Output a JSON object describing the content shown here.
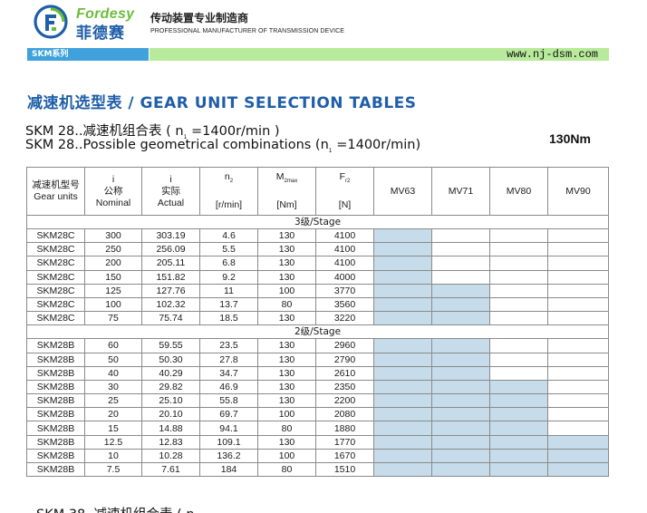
{
  "brand": {
    "name_en": "Fordesy",
    "name_cn": "菲德赛",
    "tagline_cn": "传动装置专业制造商",
    "tagline_en": "PROFESSIONAL MANUFACTURER OF TRANSMISSION DEVICE",
    "colors": {
      "green": "#6cbd3c",
      "blue": "#1f5ea8",
      "bar_blue": "#3fa2dc",
      "bar_green": "#b7ea9a",
      "cell_fill": "#c7dcea"
    }
  },
  "bar": {
    "series_label": "SKM系列",
    "url": "www.nj-dsm.com"
  },
  "title": "减速机选型表 / GEAR UNIT SELECTION TABLES",
  "subtitle_cn_pre": "SKM 28..减速机组合表 ( n",
  "subtitle_cn_sub": "1",
  "subtitle_cn_post": " =1400r/min )",
  "subtitle_en_pre": "SKM 28..Possible geometrical combinations (n",
  "subtitle_en_sub": "1",
  "subtitle_en_post": " =1400r/min)",
  "torque": "130Nm",
  "table": {
    "headers": {
      "model_cn": "减速机型号",
      "model_en": "Gear units",
      "i_nominal_sym": "i",
      "i_nominal_cn": "公称",
      "i_nominal_en": "Nominal",
      "i_actual_sym": "i",
      "i_actual_cn": "实际",
      "i_actual_en": "Actual",
      "n2_sym": "n",
      "n2_sub": "2",
      "n2_unit": "[r/min]",
      "m2_sym": "M",
      "m2_sub": "2max",
      "m2_unit": "[Nm]",
      "fr2_sym": "F",
      "fr2_sub": "r2",
      "fr2_unit": "[N]",
      "motors": [
        "MV63",
        "MV71",
        "MV80",
        "MV90"
      ]
    },
    "groups": [
      {
        "stage": "3级/Stage",
        "rows": [
          {
            "model": "SKM28C",
            "i_nom": "300",
            "i_act": "303.19",
            "n2": "4.6",
            "m2": "130",
            "fr2": "4100",
            "motors": [
              true,
              false,
              false,
              false
            ]
          },
          {
            "model": "SKM28C",
            "i_nom": "250",
            "i_act": "256.09",
            "n2": "5.5",
            "m2": "130",
            "fr2": "4100",
            "motors": [
              true,
              false,
              false,
              false
            ]
          },
          {
            "model": "SKM28C",
            "i_nom": "200",
            "i_act": "205.11",
            "n2": "6.8",
            "m2": "130",
            "fr2": "4100",
            "motors": [
              true,
              false,
              false,
              false
            ]
          },
          {
            "model": "SKM28C",
            "i_nom": "150",
            "i_act": "151.82",
            "n2": "9.2",
            "m2": "130",
            "fr2": "4000",
            "motors": [
              true,
              false,
              false,
              false
            ]
          },
          {
            "model": "SKM28C",
            "i_nom": "125",
            "i_act": "127.76",
            "n2": "11",
            "m2": "100",
            "fr2": "3770",
            "motors": [
              true,
              true,
              false,
              false
            ]
          },
          {
            "model": "SKM28C",
            "i_nom": "100",
            "i_act": "102.32",
            "n2": "13.7",
            "m2": "80",
            "fr2": "3560",
            "motors": [
              true,
              true,
              false,
              false
            ]
          },
          {
            "model": "SKM28C",
            "i_nom": "75",
            "i_act": "75.74",
            "n2": "18.5",
            "m2": "130",
            "fr2": "3220",
            "motors": [
              true,
              true,
              false,
              false
            ]
          }
        ]
      },
      {
        "stage": "2级/Stage",
        "rows": [
          {
            "model": "SKM28B",
            "i_nom": "60",
            "i_act": "59.55",
            "n2": "23.5",
            "m2": "130",
            "fr2": "2960",
            "motors": [
              true,
              true,
              false,
              false
            ]
          },
          {
            "model": "SKM28B",
            "i_nom": "50",
            "i_act": "50.30",
            "n2": "27.8",
            "m2": "130",
            "fr2": "2790",
            "motors": [
              true,
              true,
              false,
              false
            ]
          },
          {
            "model": "SKM28B",
            "i_nom": "40",
            "i_act": "40.29",
            "n2": "34.7",
            "m2": "130",
            "fr2": "2610",
            "motors": [
              true,
              true,
              false,
              false
            ]
          },
          {
            "model": "SKM28B",
            "i_nom": "30",
            "i_act": "29.82",
            "n2": "46.9",
            "m2": "130",
            "fr2": "2350",
            "motors": [
              true,
              true,
              true,
              false
            ]
          },
          {
            "model": "SKM28B",
            "i_nom": "25",
            "i_act": "25.10",
            "n2": "55.8",
            "m2": "130",
            "fr2": "2200",
            "motors": [
              true,
              true,
              true,
              false
            ]
          },
          {
            "model": "SKM28B",
            "i_nom": "20",
            "i_act": "20.10",
            "n2": "69.7",
            "m2": "100",
            "fr2": "2080",
            "motors": [
              true,
              true,
              true,
              false
            ]
          },
          {
            "model": "SKM28B",
            "i_nom": "15",
            "i_act": "14.88",
            "n2": "94.1",
            "m2": "80",
            "fr2": "1880",
            "motors": [
              true,
              true,
              true,
              false
            ]
          },
          {
            "model": "SKM28B",
            "i_nom": "12.5",
            "i_act": "12.83",
            "n2": "109.1",
            "m2": "130",
            "fr2": "1770",
            "motors": [
              true,
              true,
              true,
              true
            ]
          },
          {
            "model": "SKM28B",
            "i_nom": "10",
            "i_act": "10.28",
            "n2": "136.2",
            "m2": "100",
            "fr2": "1670",
            "motors": [
              true,
              true,
              true,
              true
            ]
          },
          {
            "model": "SKM28B",
            "i_nom": "7.5",
            "i_act": "7.61",
            "n2": "184",
            "m2": "80",
            "fr2": "1510",
            "motors": [
              true,
              true,
              true,
              true
            ]
          }
        ]
      }
    ]
  },
  "next_subtitle": "SKM 38..减速机组合表 ( n"
}
